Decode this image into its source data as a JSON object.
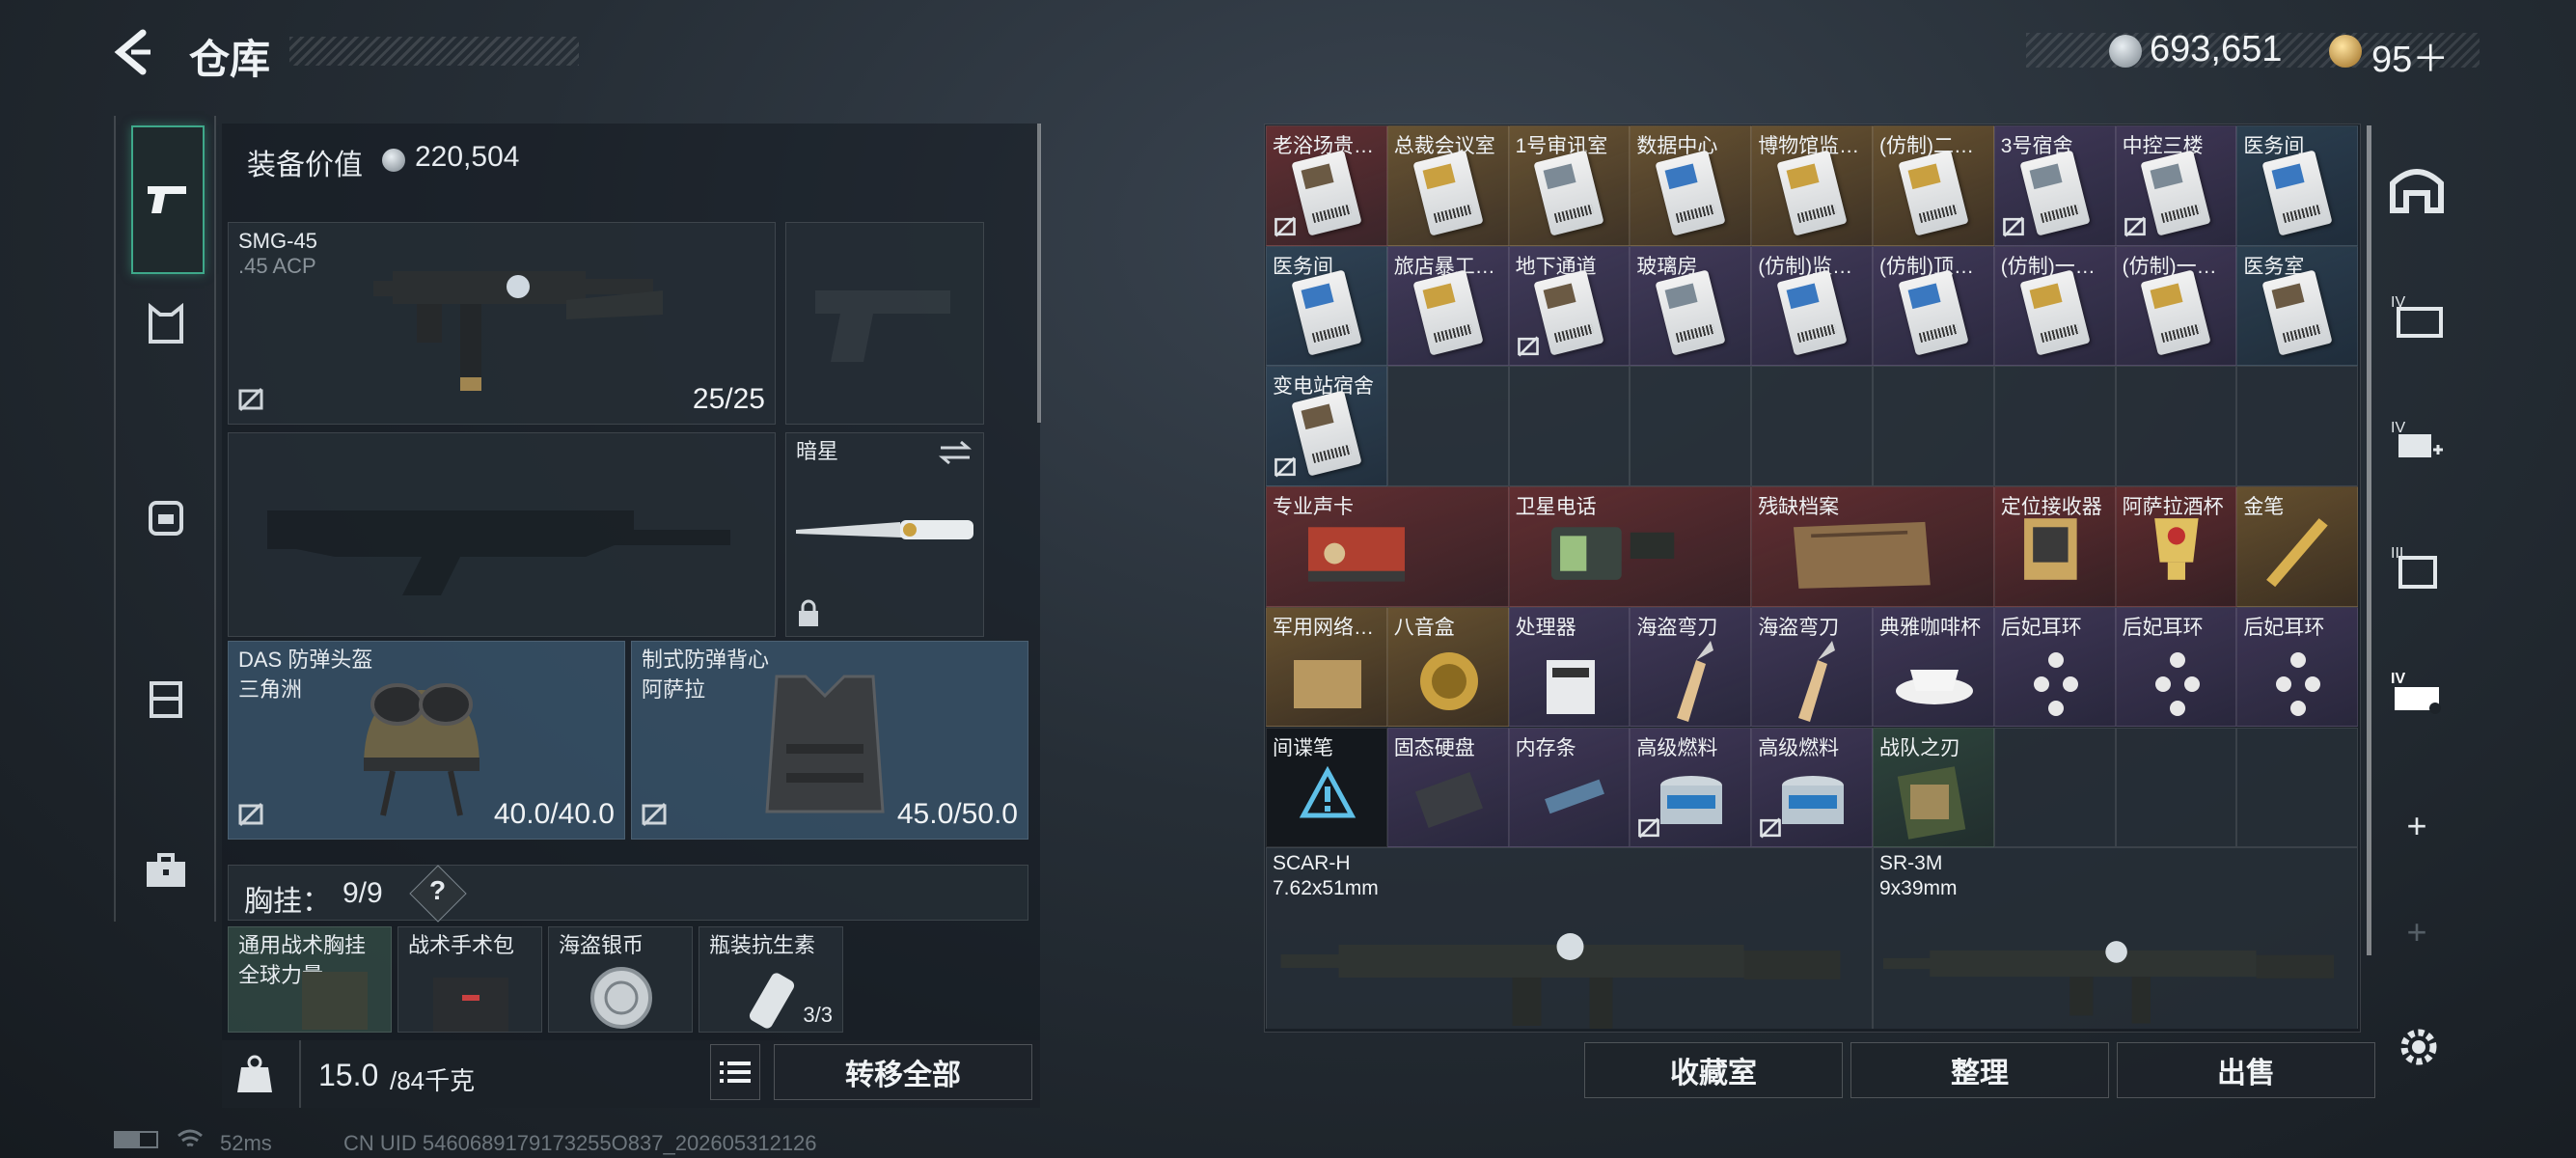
{
  "header": {
    "title": "仓库"
  },
  "currency": {
    "coins": "693,651",
    "tickets": "95＋"
  },
  "equipment": {
    "value_label": "装备价值",
    "value": "220,504",
    "primary": {
      "name": "SMG-45",
      "ammo": ".45 ACP",
      "count": "25/25"
    },
    "melee": {
      "name": "暗星"
    },
    "helmet": {
      "name": "DAS 防弹头盔",
      "tag": "三角洲",
      "durability": "40.0/40.0"
    },
    "armor": {
      "name": "制式防弹背心",
      "tag": "阿萨拉",
      "durability": "45.0/50.0"
    },
    "chest_rig": {
      "label": "胸挂：",
      "capacity": "9/9",
      "help": "?"
    },
    "rig_items": [
      {
        "name": "通用战术胸挂",
        "sub": "全球力量"
      },
      {
        "name": "战术手术包",
        "sub": ""
      },
      {
        "name": "海盗银币",
        "sub": ""
      },
      {
        "name": "瓶装抗生素",
        "sub": "3/3"
      }
    ],
    "weight": "15.0",
    "weight_cap": "/84千克",
    "transfer_all": "转移全部"
  },
  "storage": {
    "cards_row1": [
      {
        "name": "老浴场贵…",
        "rarity": "red",
        "card": "brown",
        "noins": true
      },
      {
        "name": "总裁会议室",
        "rarity": "gold",
        "card": "gold",
        "noins": false
      },
      {
        "name": "1号审讯室",
        "rarity": "gold",
        "card": "",
        "noins": false
      },
      {
        "name": "数据中心",
        "rarity": "gold",
        "card": "blue",
        "noins": false
      },
      {
        "name": "博物馆监…",
        "rarity": "gold",
        "card": "gold",
        "noins": false
      },
      {
        "name": "(仿制)二…",
        "rarity": "gold",
        "card": "gold",
        "noins": false
      },
      {
        "name": "3号宿舍",
        "rarity": "purple",
        "card": "",
        "noins": true
      },
      {
        "name": "中控三楼",
        "rarity": "purple",
        "card": "",
        "noins": true
      },
      {
        "name": "医务间",
        "rarity": "blue",
        "card": "blue",
        "noins": false
      }
    ],
    "cards_row2": [
      {
        "name": "医务间",
        "rarity": "blue",
        "card": "blue",
        "noins": false
      },
      {
        "name": "旅店暴工…",
        "rarity": "purple",
        "card": "gold",
        "noins": false
      },
      {
        "name": "地下通道",
        "rarity": "purple",
        "card": "brown",
        "noins": true
      },
      {
        "name": "玻璃房",
        "rarity": "purple",
        "card": "",
        "noins": false
      },
      {
        "name": "(仿制)监…",
        "rarity": "purple",
        "card": "blue",
        "noins": false
      },
      {
        "name": "(仿制)顶…",
        "rarity": "purple",
        "card": "blue",
        "noins": false
      },
      {
        "name": "(仿制)一…",
        "rarity": "purple",
        "card": "gold",
        "noins": false
      },
      {
        "name": "(仿制)一…",
        "rarity": "purple",
        "card": "gold",
        "noins": false
      },
      {
        "name": "医务室",
        "rarity": "blue",
        "card": "brown",
        "noins": false
      }
    ],
    "cards_row3": [
      {
        "name": "变电站宿舍",
        "rarity": "blue",
        "card": "brown",
        "noins": true
      }
    ],
    "items_row4": [
      {
        "name": "专业声卡",
        "rarity": "red",
        "span": 2
      },
      {
        "name": "卫星电话",
        "rarity": "red",
        "span": 2
      },
      {
        "name": "残缺档案",
        "rarity": "red",
        "span": 2
      },
      {
        "name": "定位接收器",
        "rarity": "red",
        "span": 1
      },
      {
        "name": "阿萨拉酒杯",
        "rarity": "red",
        "span": 1
      },
      {
        "name": "金笔",
        "rarity": "gold",
        "span": 1
      }
    ],
    "items_row5": [
      {
        "name": "军用网络…",
        "rarity": "gold"
      },
      {
        "name": "八音盒",
        "rarity": "gold"
      },
      {
        "name": "处理器",
        "rarity": "purple"
      },
      {
        "name": "海盗弯刀",
        "rarity": "purple"
      },
      {
        "name": "海盗弯刀",
        "rarity": "purple"
      },
      {
        "name": "典雅咖啡杯",
        "rarity": "purple"
      },
      {
        "name": "后妃耳环",
        "rarity": "purple"
      },
      {
        "name": "后妃耳环",
        "rarity": "purple"
      },
      {
        "name": "后妃耳环",
        "rarity": "purple"
      }
    ],
    "items_row6": [
      {
        "name": "间谍笔",
        "rarity": "dark",
        "noins": false
      },
      {
        "name": "固态硬盘",
        "rarity": "purple",
        "noins": false
      },
      {
        "name": "内存条",
        "rarity": "purple",
        "noins": false
      },
      {
        "name": "高级燃料",
        "rarity": "purple",
        "noins": true
      },
      {
        "name": "高级燃料",
        "rarity": "purple",
        "noins": true
      },
      {
        "name": "战队之刃",
        "rarity": "green",
        "noins": false
      }
    ],
    "weapons": [
      {
        "name": "SCAR-H",
        "ammo": "7.62x51mm"
      },
      {
        "name": "SR-3M",
        "ammo": "9x39mm"
      }
    ],
    "buttons": {
      "collection": "收藏室",
      "sort": "整理",
      "sell": "出售"
    }
  },
  "status": {
    "ping": "52ms",
    "uid": "CN UID 5460689179173255O837_202605312126"
  },
  "colors": {
    "accent": "#3ea88a",
    "red": "#8c3232",
    "gold": "#966e32",
    "purple": "#5a4678",
    "blue": "#375570"
  }
}
